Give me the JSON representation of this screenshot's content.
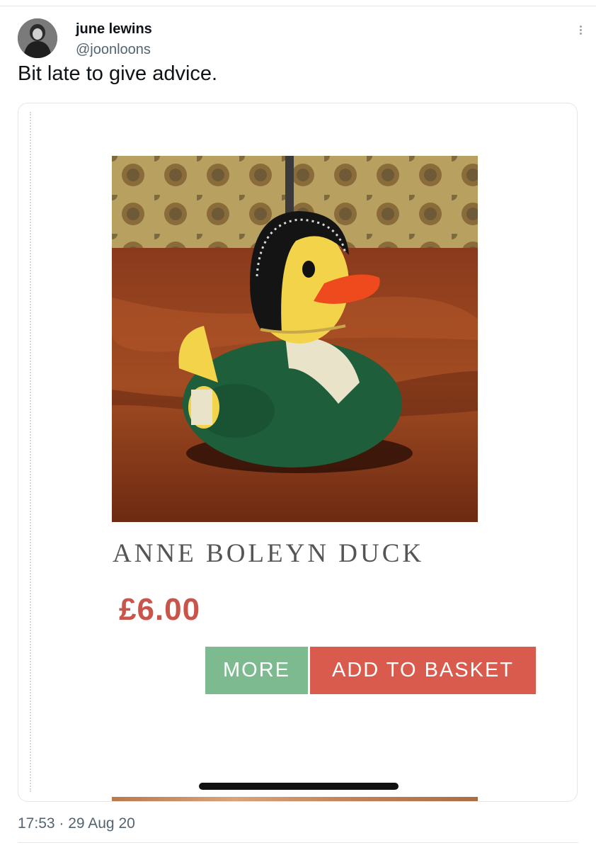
{
  "tweet": {
    "author_name": "june lewins",
    "author_handle": "@joonloons",
    "text": "Bit late to give advice.",
    "timestamp": "17:53 · 29 Aug 20",
    "more_icon": "more-vertical-icon"
  },
  "product_card": {
    "title": "ANNE BOLEYN DUCK",
    "price": "£6.00",
    "more_label": "MORE",
    "add_to_basket_label": "ADD TO BASKET"
  },
  "colors": {
    "price": "#c9544a",
    "more_button": "#7dba8f",
    "basket_button": "#d95b4e",
    "handle": "#536471"
  }
}
